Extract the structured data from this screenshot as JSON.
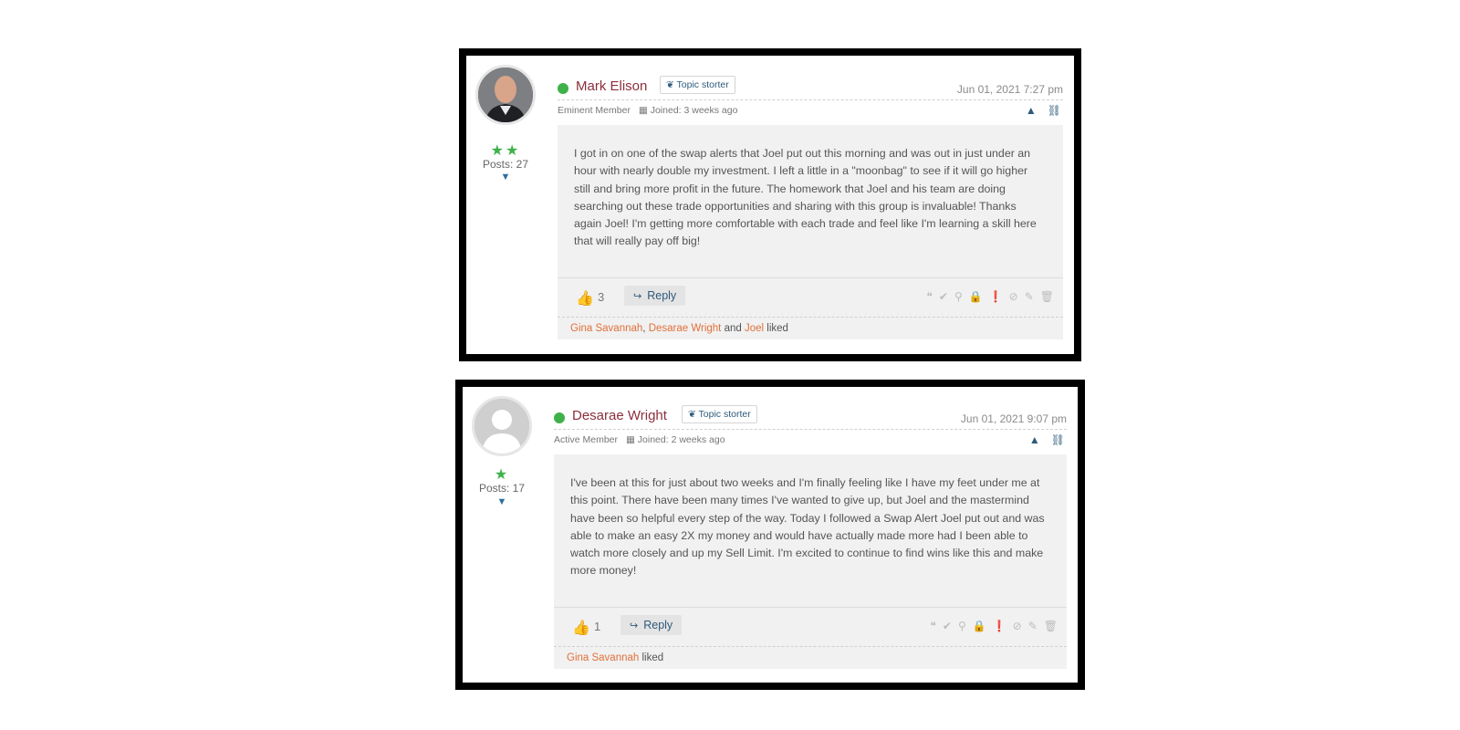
{
  "posts": [
    {
      "author": "Mark Elison",
      "badge": "Topic storter",
      "date": "Jun 01, 2021 7:27 pm",
      "rank": "Eminent Member",
      "joined": "Joined: 3 weeks ago",
      "stars": "★★",
      "posts": "Posts: 27",
      "text": "I got in on one of the swap alerts that Joel put out this morning and was out in just under an hour with nearly double my investment.  I left a little in a \"moonbag\" to see if it will go higher still and bring more profit in the future.  The homework that Joel and his team are doing searching out these trade opportunities and sharing with this group is invaluable!  Thanks again Joel!  I'm getting more comfortable with each trade and feel like I'm learning a skill here that will really pay off big!",
      "likes": "3",
      "reply_label": "Reply",
      "liked_names": [
        "Gina Savannah",
        "Desarae Wright",
        "Joel"
      ],
      "liked_sep1": ", ",
      "liked_and": " and ",
      "liked_suffix": " liked"
    },
    {
      "author": "Desarae Wright",
      "badge": "Topic storter",
      "date": "Jun 01, 2021 9:07 pm",
      "rank": "Active Member",
      "joined": "Joined: 2 weeks ago",
      "stars": "★",
      "posts": "Posts: 17",
      "text": "I've been at this for just about two weeks and I'm finally feeling like I have my feet under me at this point.  There have been many times I've wanted to give up, but Joel and the mastermind have been so helpful every step of the way.  Today I followed a Swap Alert Joel put out and was able to make an easy 2X my money and would have actually made more had I been able to watch more closely and up my Sell Limit.  I'm excited to continue to find wins like this and make more money!",
      "likes": "1",
      "reply_label": "Reply",
      "liked_names": [
        "Gina Savannah"
      ],
      "liked_suffix": " liked"
    }
  ],
  "colors": {
    "online": "#3fb14a",
    "author": "#8c2f3b",
    "link": "#e0703a",
    "accent": "#2e5a7a"
  },
  "icons": [
    "online-dot",
    "leaf-icon",
    "calendar-icon",
    "warning-icon",
    "link-icon",
    "thumbs-up-icon",
    "reply-arrow-icon",
    "quote-icon",
    "check-icon",
    "pin-icon",
    "lock-icon",
    "info-icon",
    "hide-icon",
    "edit-icon",
    "trash-icon"
  ]
}
